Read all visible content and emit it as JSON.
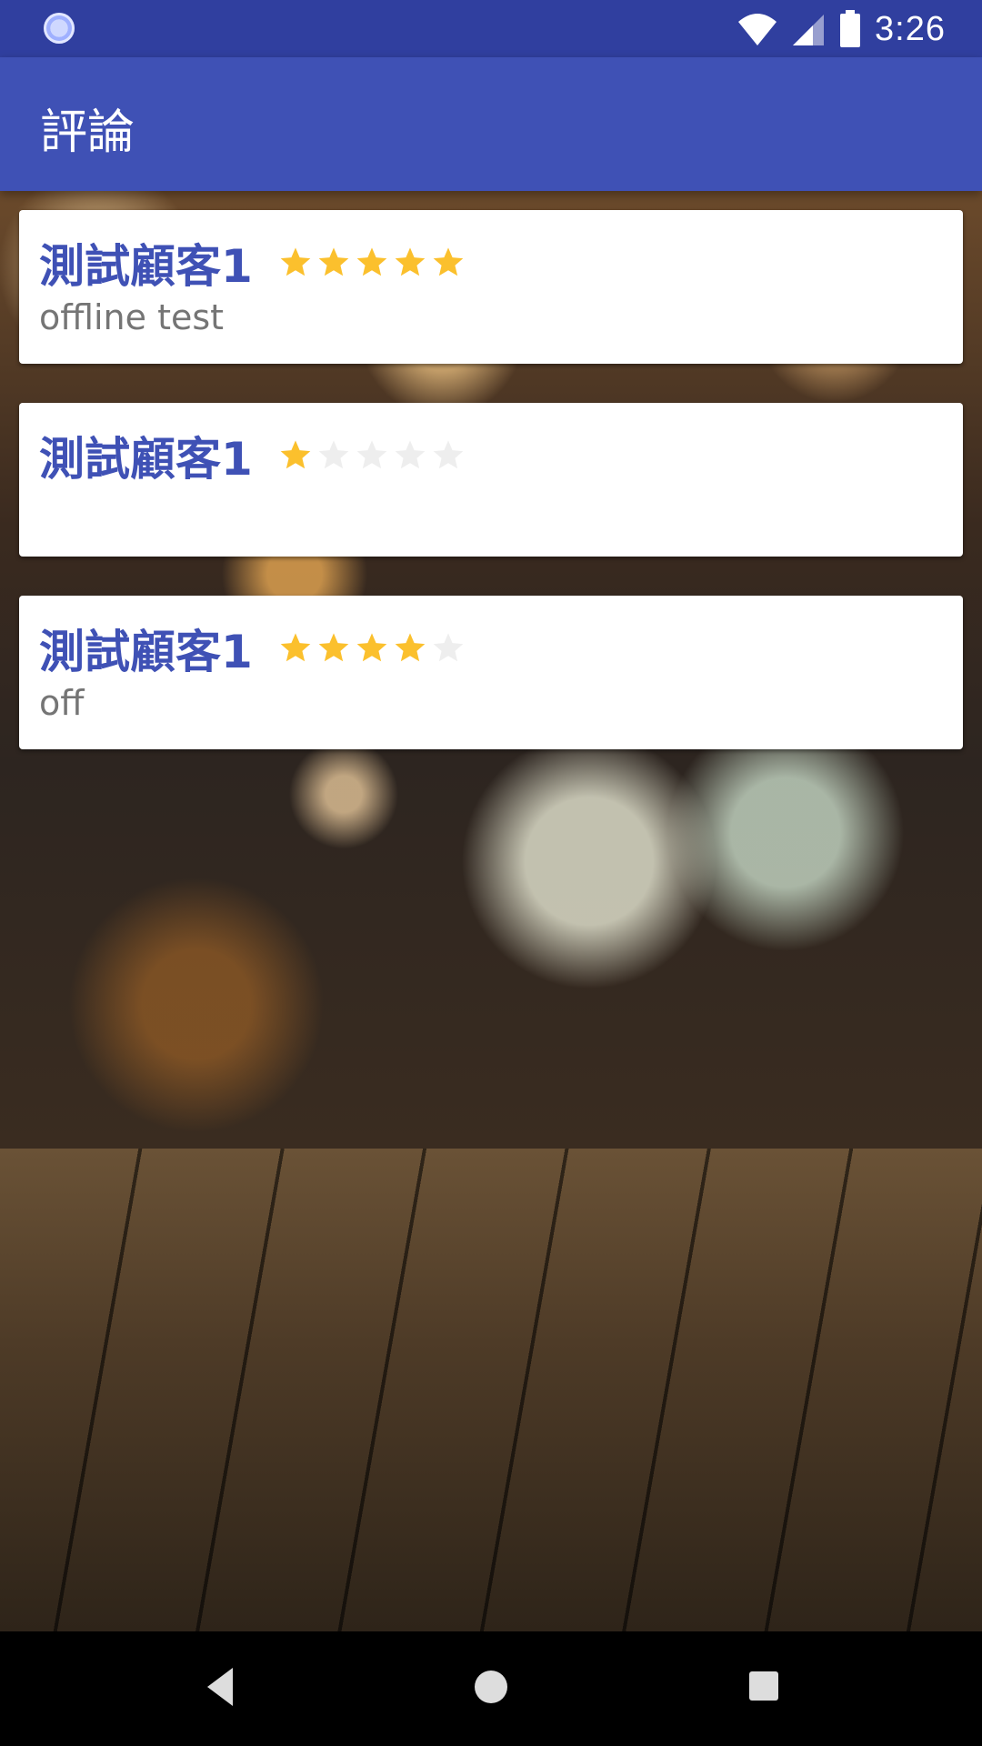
{
  "status_bar": {
    "time": "3:26",
    "icons": [
      "sync-icon",
      "wifi-icon",
      "signal-icon",
      "battery-icon"
    ]
  },
  "app_bar": {
    "title": "評論"
  },
  "reviews": [
    {
      "name": "測試顧客1",
      "rating": 5,
      "max_rating": 5,
      "comment": "offline test"
    },
    {
      "name": "測試顧客1",
      "rating": 1,
      "max_rating": 5,
      "comment": ""
    },
    {
      "name": "測試顧客1",
      "rating": 4,
      "max_rating": 5,
      "comment": "off"
    }
  ],
  "colors": {
    "status_bar": "#303F9F",
    "app_bar": "#3F51B5",
    "name_text": "#3F51B5",
    "star_filled": "#FBC02D",
    "star_empty": "#EEEEEE",
    "comment_text": "#757575"
  },
  "nav_bar": {
    "icons": [
      "back-icon",
      "home-icon",
      "recents-icon"
    ]
  }
}
